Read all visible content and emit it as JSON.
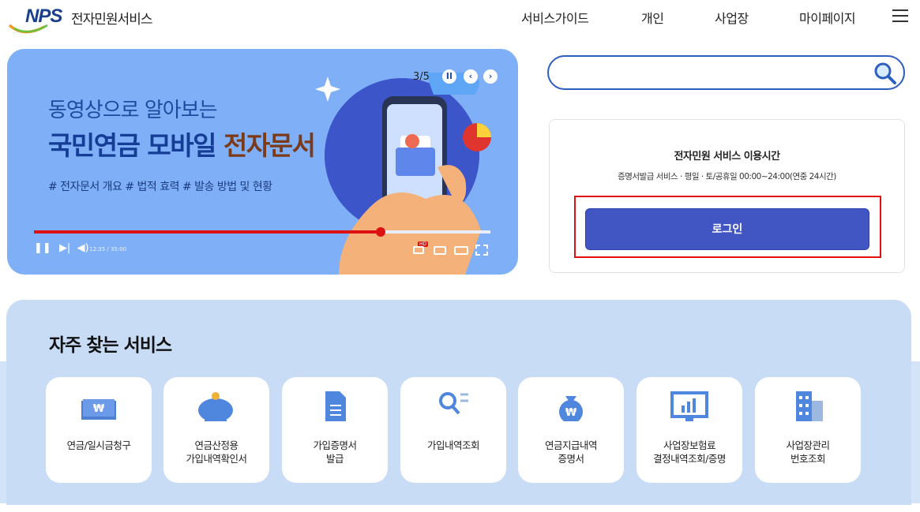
{
  "header": {
    "logo_text": "NPS",
    "site_title": "전자민원서비스",
    "nav": [
      "서비스가이드",
      "개인",
      "사업장",
      "마이페이지"
    ]
  },
  "banner": {
    "subtitle": "동영상으로 알아보는",
    "title_main": "국민연금 모바일 ",
    "title_highlight": "전자문서",
    "tags": "# 전자문서 개요  # 법적 효력  # 발송 방법 및 현황",
    "counter": "3/5",
    "time": "12:35 / 35:00",
    "progress": 0.76,
    "badge_hd": "HD"
  },
  "search": {
    "placeholder": ""
  },
  "login_box": {
    "title": "전자민원 서비스 이용시간",
    "description": "증명서발급 서비스 · 평일 · 토/공휴일 00:00~24:00(연중 24시간)",
    "login_label": "로그인"
  },
  "favorites": {
    "title": "자주 찾는 서비스",
    "items": [
      {
        "label": "연금/일시금청구",
        "icon": "won-card-icon"
      },
      {
        "label": "연금산정용\n가입내역확인서",
        "icon": "piggy-bank-icon"
      },
      {
        "label": "가입증명서\n발급",
        "icon": "document-icon"
      },
      {
        "label": "가입내역조회",
        "icon": "search-list-icon"
      },
      {
        "label": "연금지급내역\n증명서",
        "icon": "money-bag-icon"
      },
      {
        "label": "사업장보험료\n결정내역조회/증명",
        "icon": "monitor-chart-icon"
      },
      {
        "label": "사업장관리\n번호조회",
        "icon": "building-icon"
      }
    ]
  },
  "colors": {
    "brand_blue": "#1b3f8f",
    "login_button": "#4155c3",
    "highlight_border": "#e01010",
    "banner_bg": "#7fb0f7",
    "favorites_bg": "#c8dcf5"
  }
}
